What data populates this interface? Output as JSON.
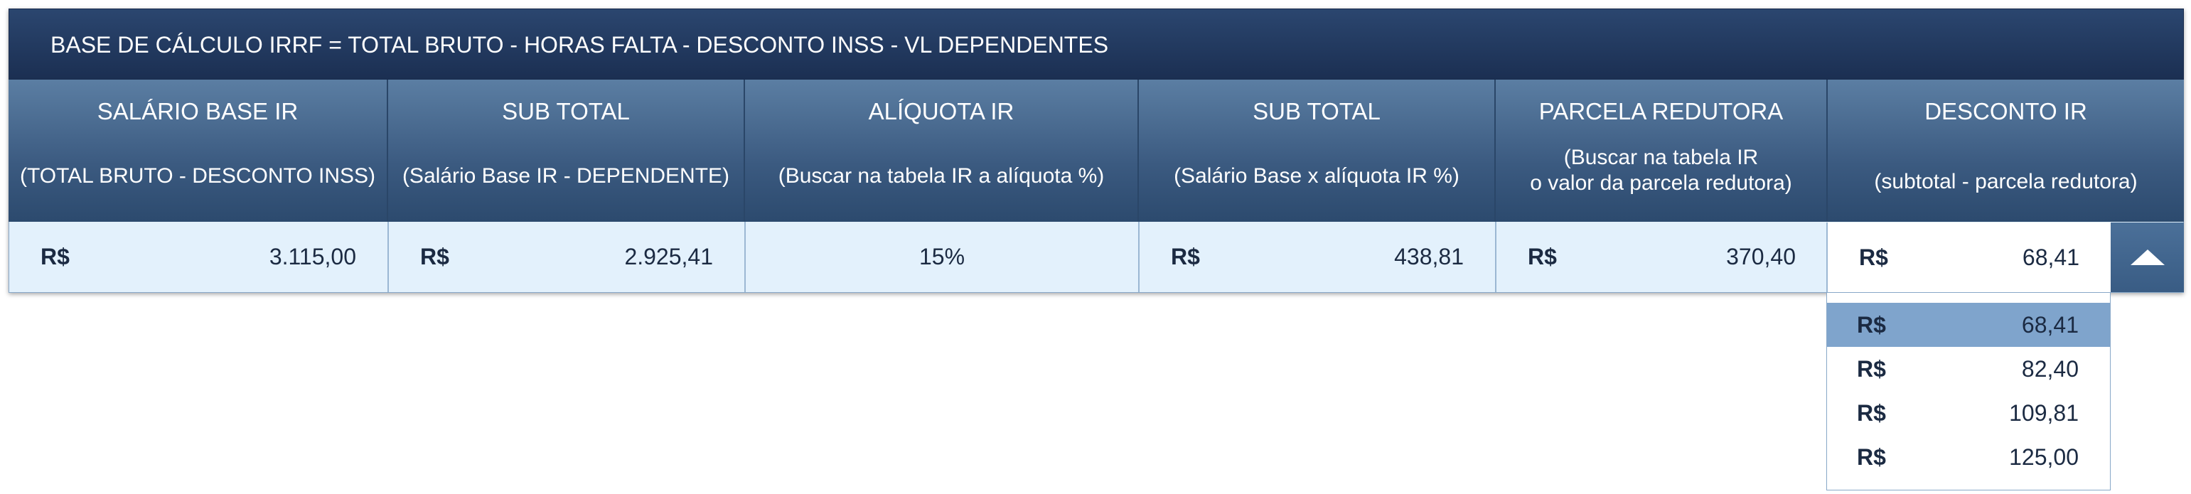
{
  "title": "BASE DE CÁLCULO IRRF = TOTAL BRUTO - HORAS FALTA - DESCONTO INSS - VL DEPENDENTES",
  "columns": [
    {
      "title": "SALÁRIO BASE IR",
      "subtitle": "(TOTAL BRUTO - DESCONTO INSS)",
      "currency": "R$",
      "value": "3.115,00"
    },
    {
      "title": "SUB TOTAL",
      "subtitle": "(Salário Base IR - DEPENDENTE)",
      "currency": "R$",
      "value": "2.925,41"
    },
    {
      "title": "ALÍQUOTA IR",
      "subtitle": "(Buscar na tabela IR a alíquota %)",
      "value": "15%"
    },
    {
      "title": "SUB TOTAL",
      "subtitle": "(Salário Base x alíquota IR %)",
      "currency": "R$",
      "value": "438,81"
    },
    {
      "title": "PARCELA REDUTORA",
      "subtitle": "(Buscar na tabela IR\no valor da parcela redutora)",
      "currency": "R$",
      "value": "370,40"
    },
    {
      "title": "DESCONTO IR",
      "subtitle": "(subtotal - parcela redutora)",
      "currency": "R$",
      "value": "68,41"
    }
  ],
  "dropdown": {
    "icon": "triangle-up-icon",
    "selected_index": 0,
    "options": [
      {
        "currency": "R$",
        "value": "68,41"
      },
      {
        "currency": "R$",
        "value": "82,40"
      },
      {
        "currency": "R$",
        "value": "109,81"
      },
      {
        "currency": "R$",
        "value": "125,00"
      }
    ]
  },
  "colors": {
    "title_bar": "#1b2f52",
    "header": "#3b5a80",
    "value_row": "#e3f1fc",
    "selected_option": "#7fa4cc"
  }
}
